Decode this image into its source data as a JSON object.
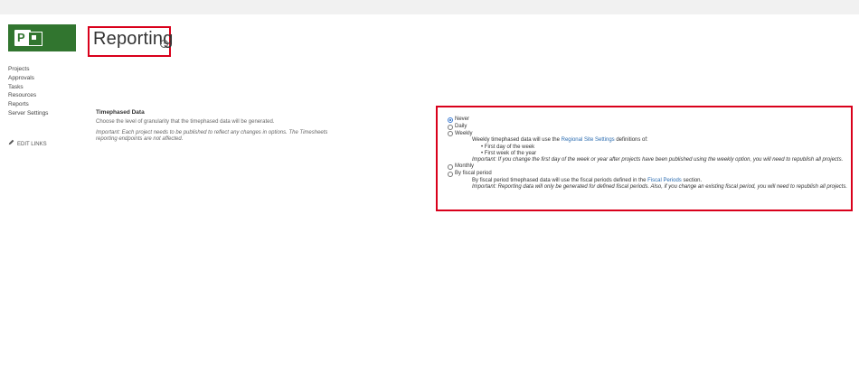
{
  "app": {
    "logo_letter": "P",
    "brand_color": "#31752f",
    "page_title": "Reporting",
    "title_icon": "info-icon"
  },
  "nav": {
    "items": [
      "Projects",
      "Approvals",
      "Tasks",
      "Resources",
      "Reports",
      "Server Settings"
    ],
    "edit_links": "EDIT LINKS"
  },
  "section": {
    "heading": "Timephased Data",
    "description": "Choose the level of granularity that the timephased data will be generated.",
    "note": "Important: Each project needs to be published to reflect any changes in options. The Timesheets reporting endpoints are not affected."
  },
  "options": {
    "never": "Never",
    "daily": "Daily",
    "weekly": "Weekly",
    "weekly_desc_pre": "Weekly timephased data will use the",
    "weekly_link": "Regional Site Settings",
    "weekly_desc_post": "definitions of:",
    "weekly_bullets": [
      "First day of the week",
      "First week of the year"
    ],
    "weekly_note": "Important: If you change the first day of the week or year after projects have been published using the weekly option, you will need to republish all projects.",
    "monthly": "Monthly",
    "fiscal": "By fiscal period",
    "fiscal_desc_pre": "By fiscal period timephased data will use the fiscal periods defined in the",
    "fiscal_link": "Fiscal Periods",
    "fiscal_desc_post": "section.",
    "fiscal_note": "Important: Reporting data will only be generated for defined fiscal periods. Also, if you change an existing fiscal period, you will need to republish all projects.",
    "selected": "Never"
  },
  "colors": {
    "highlight_border": "#d9001b",
    "link": "#2b6cb0"
  }
}
